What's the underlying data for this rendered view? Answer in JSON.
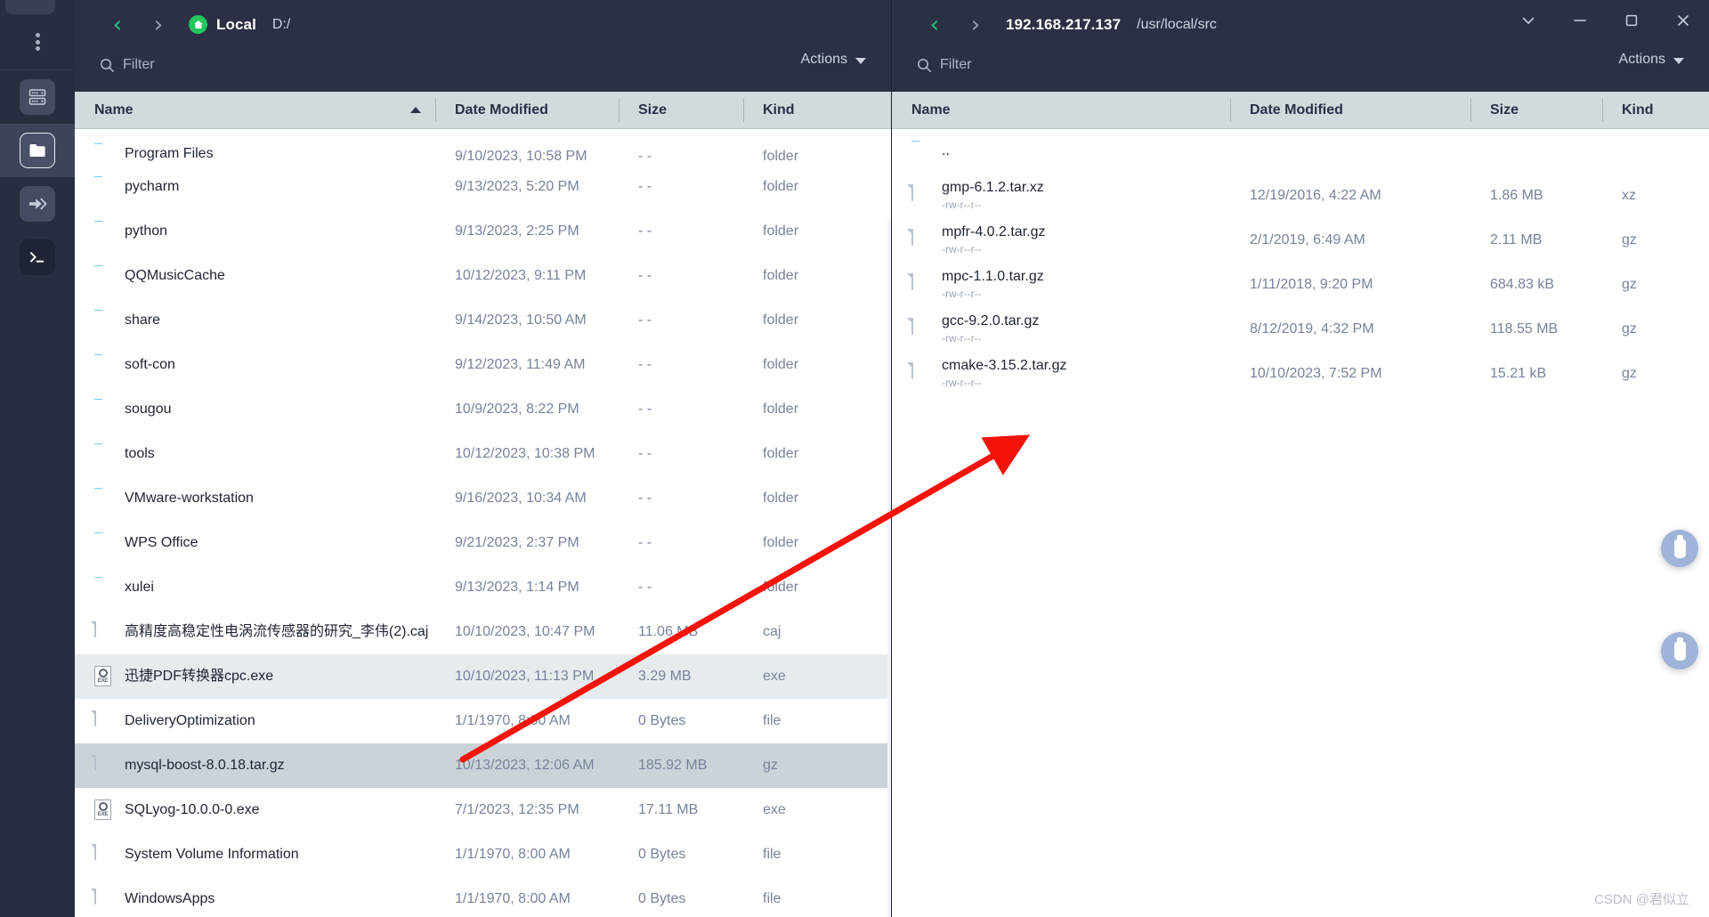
{
  "window": {
    "controls": [
      {
        "name": "chevron-down",
        "glyph": "⌄"
      },
      {
        "name": "minimize",
        "glyph": "─"
      },
      {
        "name": "maximize",
        "glyph": "☐"
      },
      {
        "name": "close",
        "glyph": "✕"
      }
    ]
  },
  "rail": {
    "menu_label": "⋮",
    "items": [
      {
        "id": "hosts",
        "label": "Hosts",
        "icon": "server-icon",
        "active": false
      },
      {
        "id": "sftp",
        "label": "SFTP",
        "icon": "folder-icon",
        "active": true
      },
      {
        "id": "port-forwarding",
        "label": "Port Forwarding",
        "icon": "arrow-forward-icon",
        "active": false
      },
      {
        "id": "terminal",
        "label": "Terminal",
        "icon": "terminal-icon",
        "active": false
      }
    ]
  },
  "left_pane": {
    "nav": {
      "back": "‹",
      "forward": "›"
    },
    "host": "Local",
    "path": "D:/",
    "filter_placeholder": "Filter",
    "actions_label": "Actions",
    "columns": [
      {
        "key": "name",
        "label": "Name",
        "sorted": true
      },
      {
        "key": "date",
        "label": "Date Modified",
        "sorted": false
      },
      {
        "key": "size",
        "label": "Size",
        "sorted": false
      },
      {
        "key": "kind",
        "label": "Kind",
        "sorted": false
      }
    ],
    "rows": [
      {
        "name": "Program Files",
        "date": "9/10/2023, 10:58 PM",
        "size": "- -",
        "kind": "folder",
        "icon": "folder",
        "state": "none",
        "clipped": true
      },
      {
        "name": "pycharm",
        "date": "9/13/2023, 5:20 PM",
        "size": "- -",
        "kind": "folder",
        "icon": "folder",
        "state": "none"
      },
      {
        "name": "python",
        "date": "9/13/2023, 2:25 PM",
        "size": "- -",
        "kind": "folder",
        "icon": "folder",
        "state": "none"
      },
      {
        "name": "QQMusicCache",
        "date": "10/12/2023, 9:11 PM",
        "size": "- -",
        "kind": "folder",
        "icon": "folder",
        "state": "none"
      },
      {
        "name": "share",
        "date": "9/14/2023, 10:50 AM",
        "size": "- -",
        "kind": "folder",
        "icon": "folder",
        "state": "none"
      },
      {
        "name": "soft-con",
        "date": "9/12/2023, 11:49 AM",
        "size": "- -",
        "kind": "folder",
        "icon": "folder",
        "state": "none"
      },
      {
        "name": "sougou",
        "date": "10/9/2023, 8:22 PM",
        "size": "- -",
        "kind": "folder",
        "icon": "folder",
        "state": "none"
      },
      {
        "name": "tools",
        "date": "10/12/2023, 10:38 PM",
        "size": "- -",
        "kind": "folder",
        "icon": "folder",
        "state": "none"
      },
      {
        "name": "VMware-workstation",
        "date": "9/16/2023, 10:34 AM",
        "size": "- -",
        "kind": "folder",
        "icon": "folder",
        "state": "none"
      },
      {
        "name": "WPS Office",
        "date": "9/21/2023, 2:37 PM",
        "size": "- -",
        "kind": "folder",
        "icon": "folder",
        "state": "none"
      },
      {
        "name": "xulei",
        "date": "9/13/2023, 1:14 PM",
        "size": "- -",
        "kind": "folder",
        "icon": "folder",
        "state": "none"
      },
      {
        "name": "高精度高稳定性电涡流传感器的研究_李伟(2).caj",
        "date": "10/10/2023, 10:47 PM",
        "size": "11.06 MB",
        "kind": "caj",
        "icon": "file",
        "state": "none"
      },
      {
        "name": "迅捷PDF转换器cpc.exe",
        "date": "10/10/2023, 11:13 PM",
        "size": "3.29 MB",
        "kind": "exe",
        "icon": "exe",
        "state": "hover"
      },
      {
        "name": "DeliveryOptimization",
        "date": "1/1/1970, 8:00 AM",
        "size": "0 Bytes",
        "kind": "file",
        "icon": "file",
        "state": "none"
      },
      {
        "name": "mysql-boost-8.0.18.tar.gz",
        "date": "10/13/2023, 12:06 AM",
        "size": "185.92 MB",
        "kind": "gz",
        "icon": "file",
        "state": "selected"
      },
      {
        "name": "SQLyog-10.0.0-0.exe",
        "date": "7/1/2023, 12:35 PM",
        "size": "17.11 MB",
        "kind": "exe",
        "icon": "exe",
        "state": "none"
      },
      {
        "name": "System Volume Information",
        "date": "1/1/1970, 8:00 AM",
        "size": "0 Bytes",
        "kind": "file",
        "icon": "file",
        "state": "none"
      },
      {
        "name": "WindowsApps",
        "date": "1/1/1970, 8:00 AM",
        "size": "0 Bytes",
        "kind": "file",
        "icon": "file",
        "state": "none"
      }
    ]
  },
  "right_pane": {
    "nav": {
      "back": "‹",
      "forward": "›"
    },
    "host": "192.168.217.137",
    "path": "/usr/local/src",
    "filter_placeholder": "Filter",
    "actions_label": "Actions",
    "columns": [
      {
        "key": "name",
        "label": "Name",
        "sorted": false
      },
      {
        "key": "date",
        "label": "Date Modified",
        "sorted": false
      },
      {
        "key": "size",
        "label": "Size",
        "sorted": false
      },
      {
        "key": "kind",
        "label": "Kind",
        "sorted": false
      }
    ],
    "rows": [
      {
        "name": "..",
        "perm": "",
        "date": "",
        "size": "",
        "kind": "",
        "icon": "folder",
        "state": "none"
      },
      {
        "name": "gmp-6.1.2.tar.xz",
        "perm": "-rw-r--r--",
        "date": "12/19/2016, 4:22 AM",
        "size": "1.86 MB",
        "kind": "xz",
        "icon": "file",
        "state": "none"
      },
      {
        "name": "mpfr-4.0.2.tar.gz",
        "perm": "-rw-r--r--",
        "date": "2/1/2019, 6:49 AM",
        "size": "2.11 MB",
        "kind": "gz",
        "icon": "file",
        "state": "none"
      },
      {
        "name": "mpc-1.1.0.tar.gz",
        "perm": "-rw-r--r--",
        "date": "1/11/2018, 9:20 PM",
        "size": "684.83 kB",
        "kind": "gz",
        "icon": "file",
        "state": "none"
      },
      {
        "name": "gcc-9.2.0.tar.gz",
        "perm": "-rw-r--r--",
        "date": "8/12/2019, 4:32 PM",
        "size": "118.55 MB",
        "kind": "gz",
        "icon": "file",
        "state": "none"
      },
      {
        "name": "cmake-3.15.2.tar.gz",
        "perm": "-rw-r--r--",
        "date": "10/10/2023, 7:52 PM",
        "size": "15.21 kB",
        "kind": "gz",
        "icon": "file",
        "state": "none"
      }
    ]
  },
  "bubbles": [
    {
      "name": "usb-device-1"
    },
    {
      "name": "usb-device-2"
    }
  ],
  "annotation": {
    "color": "#f5130b",
    "description": "red arrow from mysql-boost row to remote panel"
  },
  "watermark": "CSDN @君似立"
}
